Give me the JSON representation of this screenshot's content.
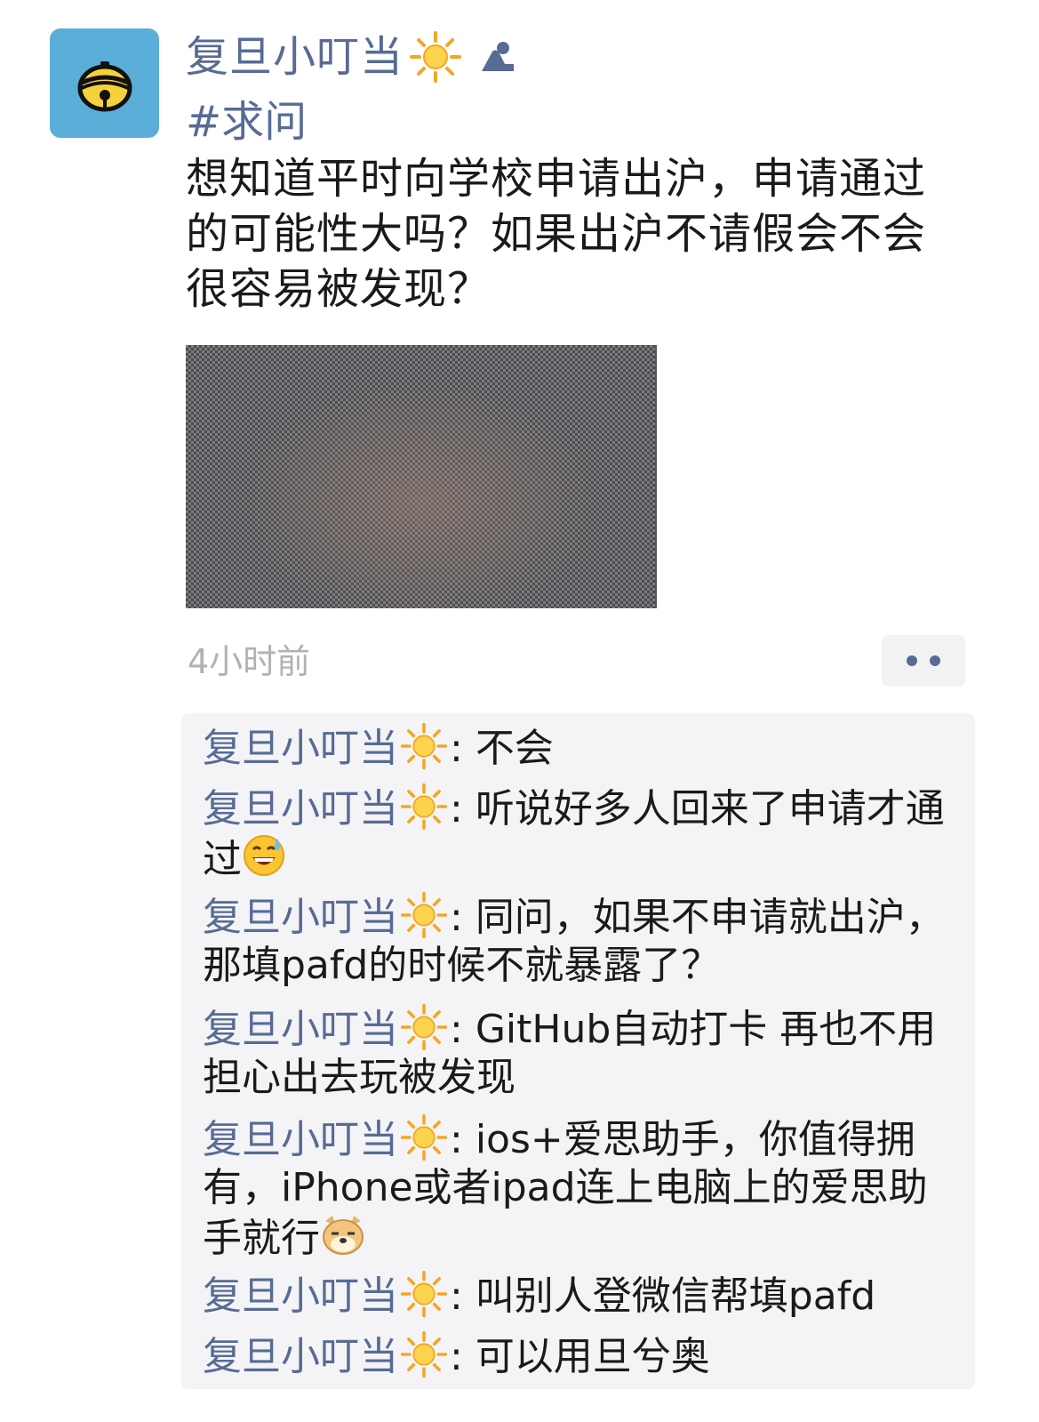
{
  "post": {
    "author": "复旦小叮当",
    "author_badge_icon": "sun-icon",
    "tag": "#求问",
    "text": "想知道平时向学校申请出沪，申请通过的可能性大吗？如果出沪不请假会不会很容易被发现？",
    "time": "4小时前"
  },
  "comments": [
    {
      "author": "复旦小叮当",
      "separator": ": ",
      "text": "不会"
    },
    {
      "author": "复旦小叮当",
      "separator": ": ",
      "text": "听说好多人回来了申请才通过",
      "emoji": "sweat-smile-emoji"
    },
    {
      "author": "复旦小叮当",
      "separator": ": ",
      "text": "同问，如果不申请就出沪，那填pafd的时候不就暴露了？"
    },
    {
      "author": "复旦小叮当",
      "separator": ": ",
      "text": "GitHub自动打卡 再也不用担心出去玩被发现"
    },
    {
      "author": "复旦小叮当",
      "separator": ": ",
      "text": "ios+爱思助手，你值得拥有，iPhone或者ipad连上电脑上的爱思助手就行",
      "emoji": "doge-emoji"
    },
    {
      "author": "复旦小叮当",
      "separator": ": ",
      "text": "叫别人登微信帮填pafd"
    },
    {
      "author": "复旦小叮当",
      "separator": ": ",
      "text": "可以用旦兮奥"
    }
  ],
  "colors": {
    "link": "#576b95",
    "avatar_bg": "#5aaed8",
    "time": "#b2b2b2",
    "comment_bg": "#f4f4f6"
  }
}
